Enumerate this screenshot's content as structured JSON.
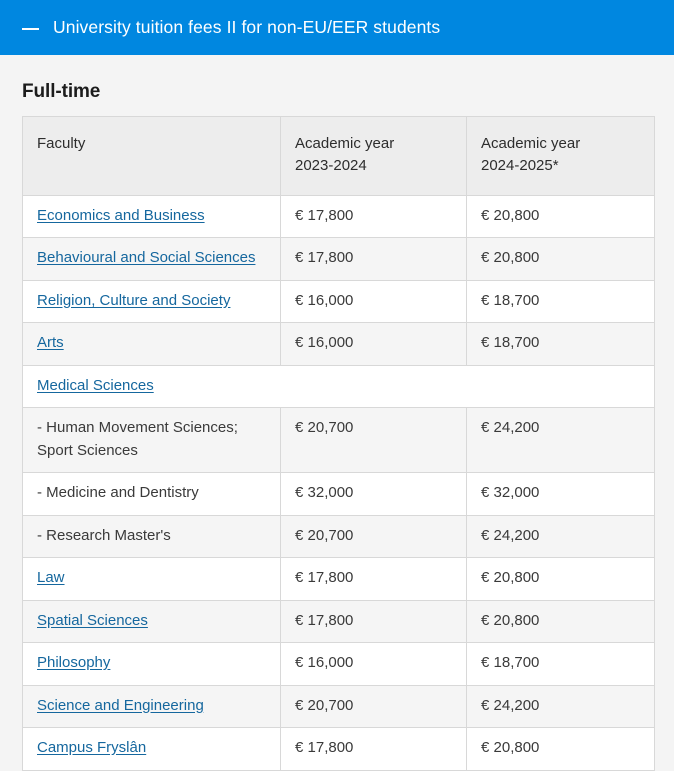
{
  "topbar": {
    "icon": "dash-icon",
    "title": "University tuition fees II for non-EU/EER students",
    "background_color": "#0087e0",
    "text_color": "#ffffff"
  },
  "page": {
    "background_color": "#f4f4f4",
    "section_heading": "Full-time"
  },
  "table": {
    "header_background": "#ededed",
    "border_color": "#d8d8d8",
    "link_color": "#15679e",
    "stripe_color": "#f5f5f5",
    "columns": [
      "Faculty",
      "Academic year 2023-2024",
      "Academic year 2024-2025*"
    ],
    "columns_multiline": [
      [
        "Faculty"
      ],
      [
        "Academic year",
        "2023-2024"
      ],
      [
        "Academic year",
        "2024-2025*"
      ]
    ],
    "rows": [
      {
        "faculty": "Economics and Business",
        "link": true,
        "y2324": "€ 17,800",
        "y2425": "€ 20,800",
        "striped": false,
        "fullspan": false
      },
      {
        "faculty": "Behavioural and Social Sciences",
        "link": true,
        "y2324": "€ 17,800",
        "y2425": "€ 20,800",
        "striped": true,
        "fullspan": false
      },
      {
        "faculty": "Religion, Culture and Society",
        "link": true,
        "y2324": "€ 16,000",
        "y2425": "€ 18,700",
        "striped": false,
        "fullspan": false
      },
      {
        "faculty": "Arts",
        "link": true,
        "y2324": "€ 16,000",
        "y2425": "€ 18,700",
        "striped": true,
        "fullspan": false
      },
      {
        "faculty": "Medical Sciences",
        "link": true,
        "y2324": "",
        "y2425": "",
        "striped": false,
        "fullspan": true
      },
      {
        "faculty": "- Human Movement Sciences; Sport Sciences",
        "link": false,
        "y2324": "€ 20,700",
        "y2425": "€ 24,200",
        "striped": true,
        "fullspan": false
      },
      {
        "faculty": "- Medicine and Dentistry",
        "link": false,
        "y2324": "€ 32,000",
        "y2425": "€ 32,000",
        "striped": false,
        "fullspan": false
      },
      {
        "faculty": "- Research Master's",
        "link": false,
        "y2324": "€ 20,700",
        "y2425": "€ 24,200",
        "striped": true,
        "fullspan": false
      },
      {
        "faculty": "Law",
        "link": true,
        "y2324": "€ 17,800",
        "y2425": "€ 20,800",
        "striped": false,
        "fullspan": false
      },
      {
        "faculty": "Spatial Sciences",
        "link": true,
        "y2324": "€ 17,800",
        "y2425": "€ 20,800",
        "striped": true,
        "fullspan": false
      },
      {
        "faculty": "Philosophy",
        "link": true,
        "y2324": "€ 16,000",
        "y2425": "€ 18,700",
        "striped": false,
        "fullspan": false
      },
      {
        "faculty": "Science and Engineering",
        "link": true,
        "y2324": "€ 20,700",
        "y2425": "€ 24,200",
        "striped": true,
        "fullspan": false
      },
      {
        "faculty": "Campus Fryslân",
        "link": true,
        "y2324": "€ 17,800",
        "y2425": "€ 20,800",
        "striped": false,
        "fullspan": false
      }
    ]
  }
}
